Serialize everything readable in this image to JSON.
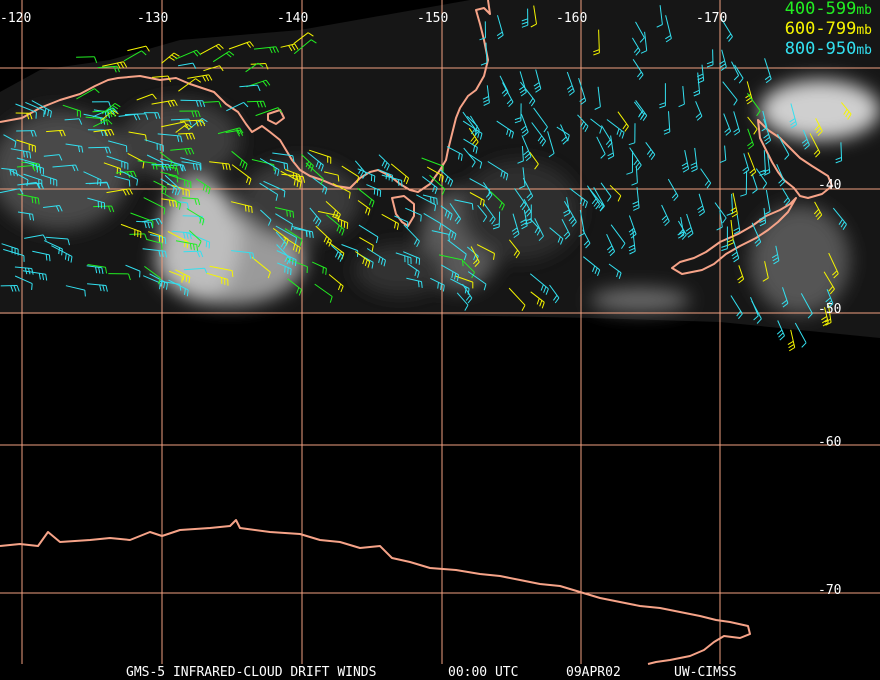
{
  "legend": [
    {
      "label": "400-599",
      "unit": "mb",
      "color": "#22ee22"
    },
    {
      "label": "600-799",
      "unit": "mb",
      "color": "#f5f500"
    },
    {
      "label": "800-950",
      "unit": "mb",
      "color": "#33e0f0"
    }
  ],
  "longitude_labels": [
    "-120",
    "-130",
    "-140",
    "-150",
    "-160",
    "-170"
  ],
  "latitude_labels": [
    "-40",
    "-50",
    "-60",
    "-70"
  ],
  "footer": {
    "product": "GMS-5 INFRARED-CLOUD DRIFT WINDS",
    "time": "00:00 UTC",
    "date": "09APR02",
    "source": "UW-CIMSS"
  },
  "colors": {
    "grid": "#f0a080",
    "coastline": "#f6a388",
    "background": "#000000"
  }
}
